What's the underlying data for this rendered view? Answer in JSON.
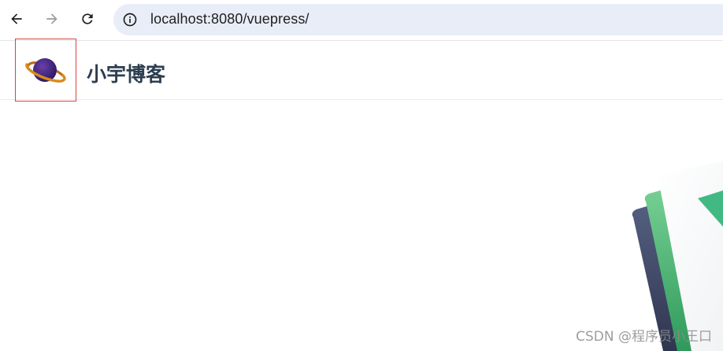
{
  "browser": {
    "url": "localhost:8080/vuepress/",
    "icons": {
      "back": "arrow-left-icon",
      "forward": "arrow-right-icon",
      "reload": "reload-icon",
      "site_info": "info-icon"
    }
  },
  "site": {
    "title": "小宇博客",
    "logo": "planet-logo-icon"
  },
  "watermark": "CSDN @程序员小王口",
  "colors": {
    "title": "#2c3e50",
    "logo_border": "#d9433e",
    "omnibox_bg": "#e9edf7",
    "vue_green": "#42b983",
    "vue_dark": "#35495e"
  }
}
